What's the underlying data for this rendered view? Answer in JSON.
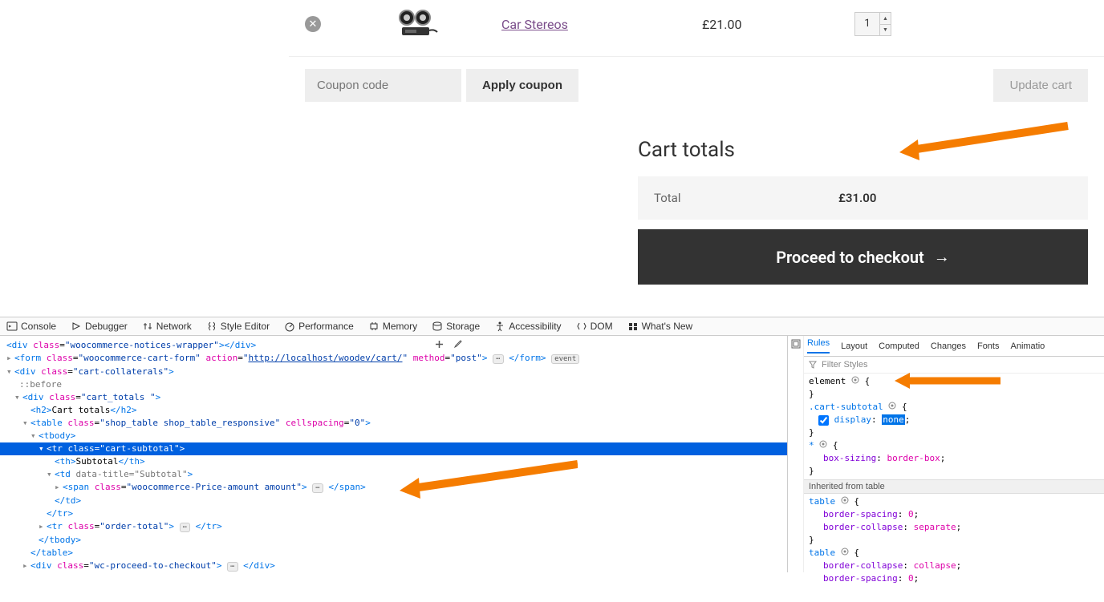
{
  "cart_row": {
    "product_name": "Car Stereos",
    "price": "£21.00",
    "qty": "1"
  },
  "actions": {
    "coupon_placeholder": "Coupon code",
    "apply_label": "Apply coupon",
    "update_label": "Update cart"
  },
  "totals": {
    "heading": "Cart totals",
    "total_label": "Total",
    "total_value": "£31.00",
    "checkout_label": "Proceed to checkout"
  },
  "devtools": {
    "tabs": [
      "Console",
      "Debugger",
      "Network",
      "Style Editor",
      "Performance",
      "Memory",
      "Storage",
      "Accessibility",
      "DOM",
      "What's New"
    ],
    "right_tabs": [
      "Rules",
      "Layout",
      "Computed",
      "Changes",
      "Fonts",
      "Animatio"
    ],
    "filter_placeholder": "Filter Styles",
    "dom": {
      "l1": "<div class=\"woocommerce-notices-wrapper\"></div>",
      "l2a": "<form class=\"woocommerce-cart-form\" action=\"",
      "l2url": "http://localhost/woodev/cart/",
      "l2b": "\" method=\"post\"> … </form>",
      "l2pill": "event",
      "l3": "<div class=\"cart-collaterals\">",
      "l4": "::before",
      "l5": "<div class=\"cart_totals \">",
      "l6": "<h2>Cart totals</h2>",
      "l7": "<table class=\"shop_table shop_table_responsive\" cellspacing=\"0\">",
      "l8": "<tbody>",
      "l9": "<tr class=\"cart-subtotal\">",
      "l10": "<th>Subtotal</th>",
      "l11": "<td data-title=\"Subtotal\">",
      "l12": "<span class=\"woocommerce-Price-amount amount\"> … </span>",
      "l13": "</td>",
      "l14": "</tr>",
      "l15": "<tr class=\"order-total\"> … </tr>",
      "l16": "</tbody>",
      "l17": "</table>",
      "l18": "<div class=\"wc-proceed-to-checkout\"> … </div>"
    },
    "rules": {
      "r1": "element",
      "r1b": "{",
      "r2": "}",
      "r3": ".cart-subtotal",
      "r3b": "{",
      "r4a": "display",
      "r4b": "none",
      "r5": "}",
      "r6": "*",
      "r6b": "{",
      "r7a": "box-sizing",
      "r7b": "border-box",
      "r8": "}",
      "inh": "Inherited from table",
      "r9": "table",
      "r9b": "{",
      "r10a": "border-spacing",
      "r10b": "0",
      "r11a": "border-collapse",
      "r11b": "separate",
      "r12": "}",
      "r13": "table",
      "r13b": "{",
      "r14a": "border-collapse",
      "r14b": "collapse",
      "r15a": "border-spacing",
      "r15b": "0"
    }
  }
}
